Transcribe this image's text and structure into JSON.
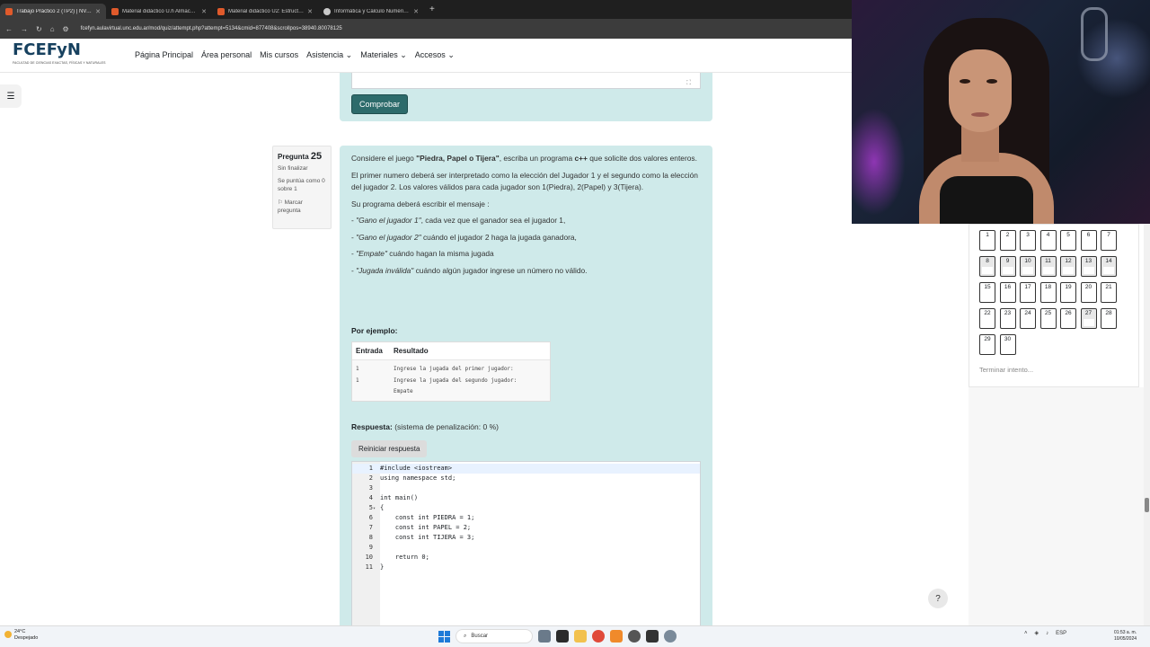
{
  "browser": {
    "tabs": [
      {
        "title": "Trabajo Práctico 2 (TP2) | NVA...",
        "active": true
      },
      {
        "title": "Material didáctico U.h Almacen...",
        "active": false
      },
      {
        "title": "Material didáctico U2: Estructu...",
        "active": false
      },
      {
        "title": "Informática y Cálculo Numéric...",
        "active": false
      }
    ],
    "url": "fcefyn.aulavirtual.unc.edu.ar/mod/quiz/attempt.php?attempt=5134&cmid=877408&scrollpos=38940.80078125"
  },
  "site": {
    "logo_text": "FCEFyN",
    "logo_sub": "FACULTAD DE CIENCIAS EXACTAS, FÍSICAS Y NATURALES",
    "menu": [
      "Página Principal",
      "Área personal",
      "Mis cursos",
      "Asistencia",
      "Materiales",
      "Accesos"
    ]
  },
  "previous": {
    "check_label": "Comprobar"
  },
  "question": {
    "label": "Pregunta",
    "number": "25",
    "state": "Sin finalizar",
    "points": "Se puntúa como 0 sobre 1",
    "flag": "Marcar pregunta",
    "p1_pre": "Considere el juego ",
    "p1_game": "\"Piedra, Papel o Tijera\"",
    "p1_mid": ", escriba un programa ",
    "p1_lang": "c++",
    "p1_post": " que solicite dos valores enteros.",
    "p2": "El primer numero deberá ser interpretado como la elección del Jugador 1 y el segundo como la elección del jugador 2.  Los valores válidos para cada jugador son 1(Piedra), 2(Papel) y 3(Tijera).",
    "p3": "Su programa deberá escribir el mensaje :",
    "items": [
      {
        "msg": "\"Gano el jugador 1\"",
        "rest": ", cada vez que el ganador sea el jugador 1,"
      },
      {
        "msg": "\"Gano el jugador 2\"",
        "rest": " cuándo el  jugador 2 haga la jugada ganadora,"
      },
      {
        "msg": "\"Empate\"",
        "rest": " cuándo hagan la misma jugada"
      },
      {
        "msg": "\"Jugada inválida\"",
        "rest": " cuándo algún jugador ingrese un número no válido."
      }
    ],
    "example_title": "Por ejemplo:",
    "example": {
      "headers": [
        "Entrada",
        "Resultado"
      ],
      "input": [
        "1",
        "1"
      ],
      "output": [
        "Ingrese la jugada del primer jugador:",
        "Ingrese la jugada del segundo jugador:",
        "Empate"
      ]
    },
    "answer_label": "Respuesta:",
    "answer_note": "(sistema de penalización: 0 %)",
    "reset_label": "Reiniciar respuesta",
    "code": [
      "#include <iostream>",
      "using namespace std;",
      "",
      "int main()",
      "{",
      "    const int PIEDRA = 1;",
      "    const int PAPEL = 2;",
      "    const int TIJERA = 3;",
      "",
      "    return 0;",
      "}"
    ]
  },
  "quiz_nav": {
    "numbers": [
      "1",
      "2",
      "3",
      "4",
      "5",
      "6",
      "7",
      "8",
      "9",
      "10",
      "11",
      "12",
      "13",
      "14",
      "15",
      "16",
      "17",
      "18",
      "19",
      "20",
      "21",
      "22",
      "23",
      "24",
      "25",
      "26",
      "27",
      "28",
      "29",
      "30"
    ],
    "finish": "Terminar intento..."
  },
  "help": "?",
  "taskbar": {
    "temp": "24°C",
    "weather": "Despejado",
    "search": "Buscar",
    "lang": "ESP",
    "time": "01:53 a. m.",
    "date": "10/05/2024"
  }
}
